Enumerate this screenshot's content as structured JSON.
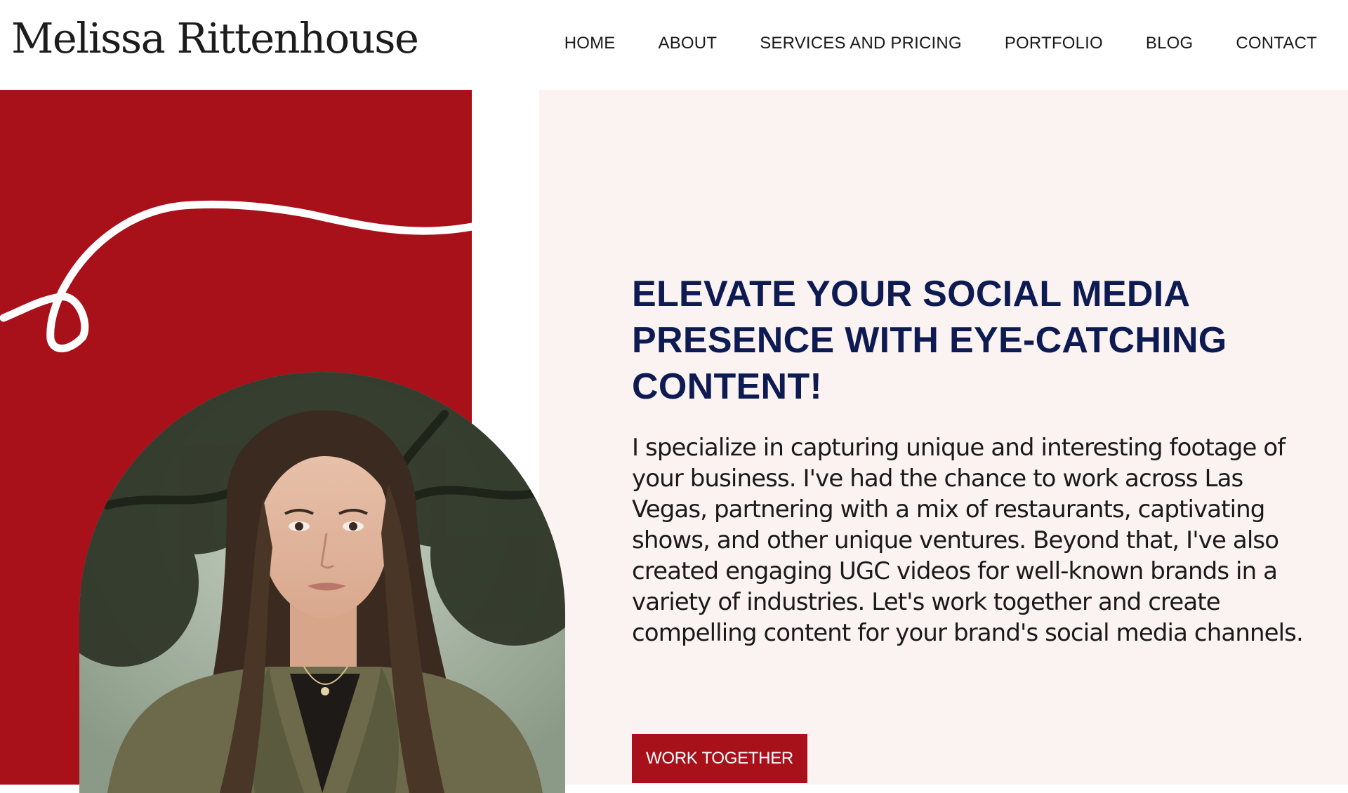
{
  "site": {
    "logo_text": "Melissa Rittenhouse"
  },
  "nav": {
    "items": [
      {
        "label": "HOME"
      },
      {
        "label": "ABOUT"
      },
      {
        "label": "SERVICES AND PRICING"
      },
      {
        "label": "PORTFOLIO"
      },
      {
        "label": "BLOG"
      },
      {
        "label": "CONTACT"
      }
    ]
  },
  "hero": {
    "headline": "ELEVATE YOUR SOCIAL MEDIA PRESENCE WITH EYE-CATCHING CONTENT!",
    "body": "I specialize in capturing unique and interesting footage of your business. I've had the chance to work across Las Vegas, partnering with a mix of restaurants, captivating shows, and other unique ventures. Beyond that, I've also created engaging UGC videos for well-known brands in a variety of industries. Let's work together and create compelling content for your brand's social media channels.",
    "cta_label": "WORK TOGETHER",
    "photo_subject": "portrait-photo"
  },
  "colors": {
    "accent_red": "#a8101a",
    "headline_navy": "#0e1a52",
    "cream_background": "#faf3f1",
    "text_dark": "#1a1a1a"
  }
}
